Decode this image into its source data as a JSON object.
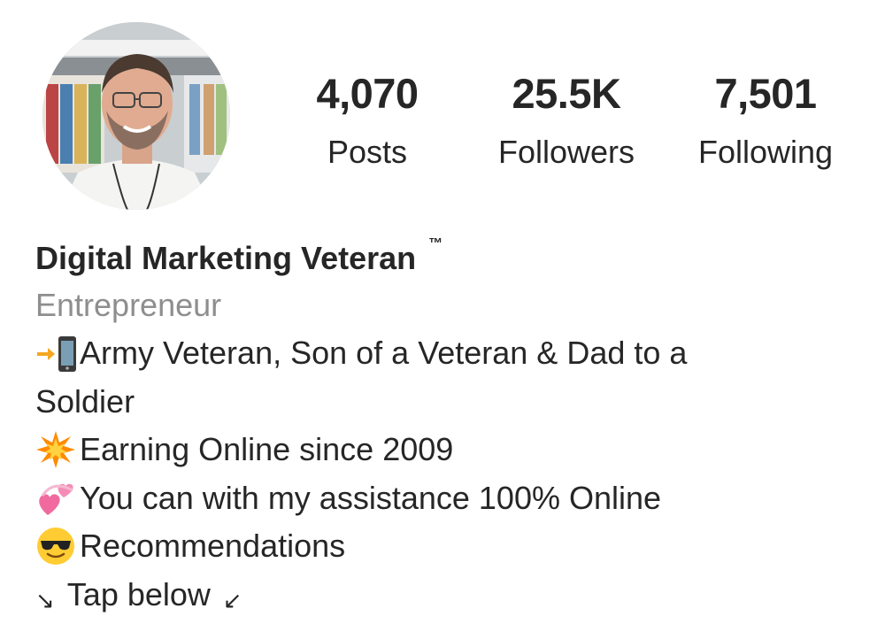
{
  "profile": {
    "stats": {
      "posts_count": "4,070",
      "posts_label": "Posts",
      "followers_count": "25.5K",
      "followers_label": "Followers",
      "following_count": "7,501",
      "following_label": "Following"
    },
    "name": "Digital Marketing Veteran",
    "trademark": "™",
    "category": "Entrepreneur",
    "bio": {
      "line1": "Army Veteran, Son of a Veteran & Dad to a",
      "line1_cont": "Soldier",
      "line2": "Earning Online since 2009",
      "line3": "You can with my assistance 100% Online",
      "line4": "Recommendations",
      "line5": "Tap below",
      "line5_arrow_before": "↘",
      "line5_arrow_after": "↙"
    },
    "icons": {
      "line1_lead": "arrow-right-phone-icon",
      "line2_lead": "collision-icon",
      "line3_lead": "revolving-hearts-icon",
      "line4_lead": "sunglasses-face-icon"
    },
    "colors": {
      "text": "#262626",
      "secondary_text": "#8e8e8e",
      "background": "#ffffff"
    }
  }
}
